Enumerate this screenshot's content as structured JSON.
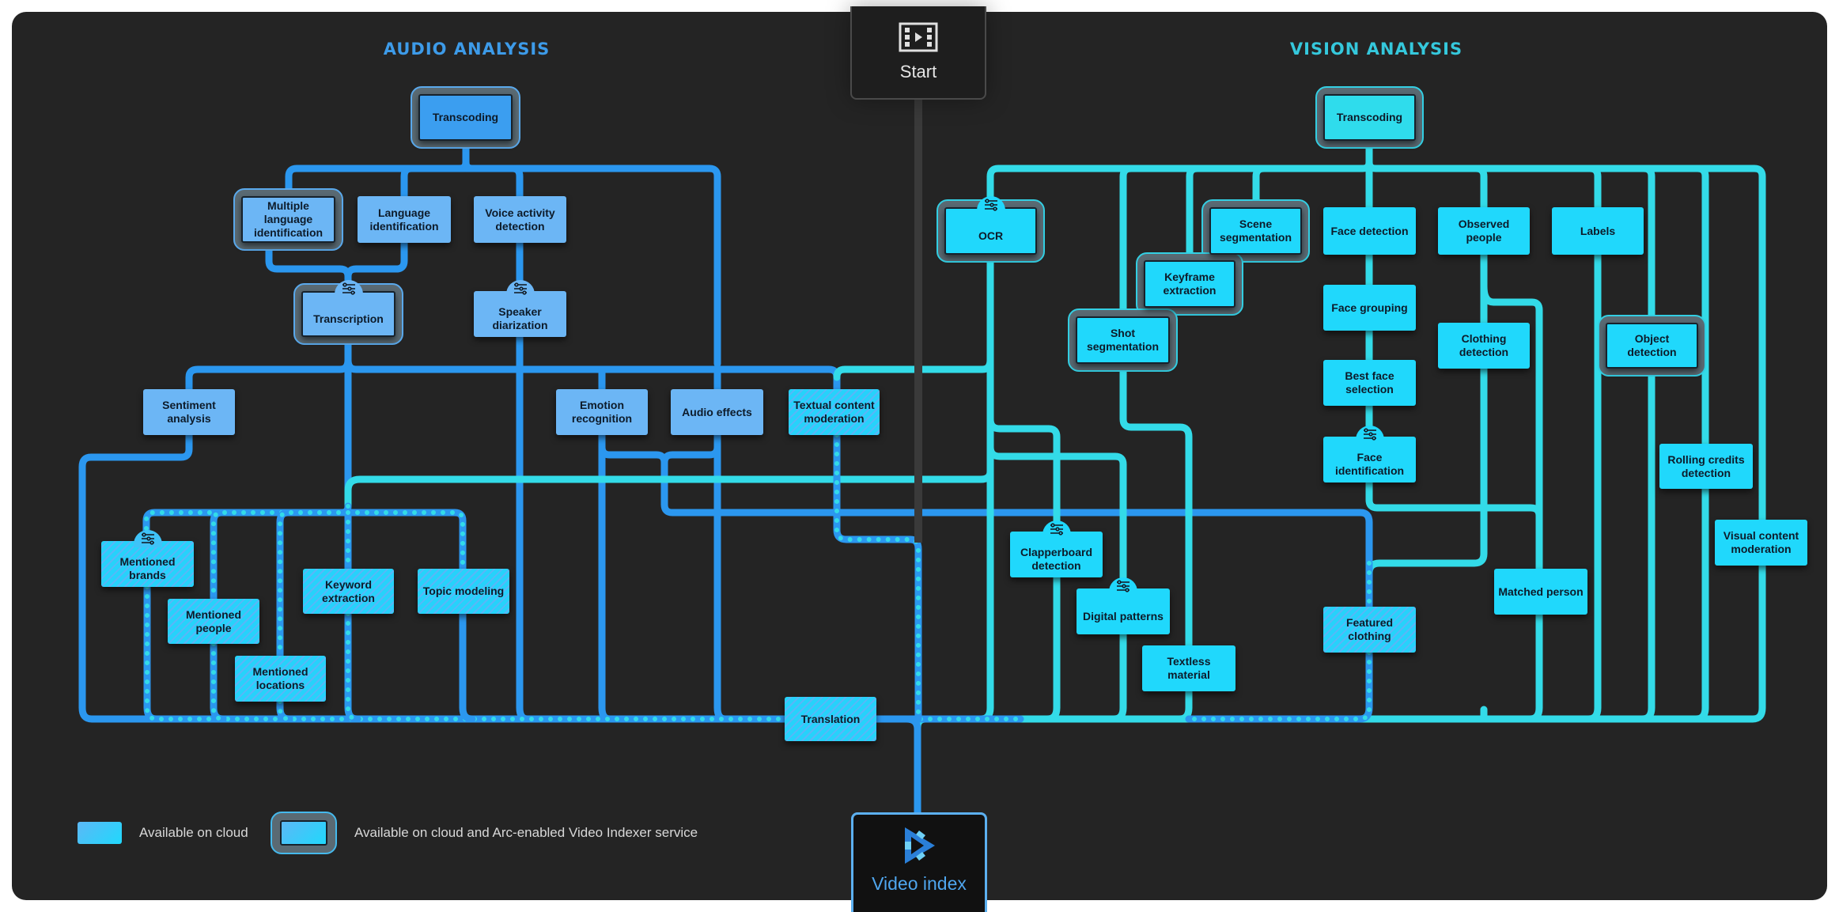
{
  "headers": {
    "audio": "AUDIO ANALYSIS",
    "vision": "VISION ANALYSIS"
  },
  "start": {
    "label": "Start",
    "icon": "film-play-icon"
  },
  "end": {
    "label": "Video index",
    "icon": "video-indexer-logo-icon"
  },
  "colors": {
    "audio_line": "#2b97ef",
    "vision_line": "#33dbe8",
    "audio_node": "#6cb6f5",
    "vision_node": "#20d8fc",
    "background": "#242424"
  },
  "legend": [
    {
      "label": "Available on cloud",
      "kind": "cloud"
    },
    {
      "label": "Available on cloud and Arc-enabled Video Indexer service",
      "kind": "cloud-and-arc"
    }
  ],
  "nodes": [
    {
      "id": "a_transcoding",
      "label": "Transcoding",
      "group": "audio",
      "arc": true,
      "configurable": false,
      "mixed": false
    },
    {
      "id": "a_multilang",
      "label": "Multiple language identification",
      "group": "audio",
      "arc": true,
      "configurable": false,
      "mixed": false
    },
    {
      "id": "a_langid",
      "label": "Language identification",
      "group": "audio",
      "arc": false,
      "configurable": false,
      "mixed": false
    },
    {
      "id": "a_vad",
      "label": "Voice activity detection",
      "group": "audio",
      "arc": false,
      "configurable": false,
      "mixed": false
    },
    {
      "id": "a_transcription",
      "label": "Transcription",
      "group": "audio",
      "arc": true,
      "configurable": true,
      "mixed": false
    },
    {
      "id": "a_diarization",
      "label": "Speaker diarization",
      "group": "audio",
      "arc": false,
      "configurable": true,
      "mixed": false
    },
    {
      "id": "a_sentiment",
      "label": "Sentiment analysis",
      "group": "audio",
      "arc": false,
      "configurable": false,
      "mixed": false
    },
    {
      "id": "a_emotion",
      "label": "Emotion recognition",
      "group": "audio",
      "arc": false,
      "configurable": false,
      "mixed": false
    },
    {
      "id": "a_effects",
      "label": "Audio effects",
      "group": "audio",
      "arc": false,
      "configurable": false,
      "mixed": false
    },
    {
      "id": "a_textmod",
      "label": "Textual content moderation",
      "group": "mixed",
      "arc": false,
      "configurable": false,
      "mixed": true
    },
    {
      "id": "a_brands",
      "label": "Mentioned brands",
      "group": "mixed",
      "arc": false,
      "configurable": true,
      "mixed": true
    },
    {
      "id": "a_keywords",
      "label": "Keyword extraction",
      "group": "mixed",
      "arc": false,
      "configurable": false,
      "mixed": true
    },
    {
      "id": "a_topics",
      "label": "Topic modeling",
      "group": "mixed",
      "arc": false,
      "configurable": false,
      "mixed": true
    },
    {
      "id": "a_people",
      "label": "Mentioned people",
      "group": "mixed",
      "arc": false,
      "configurable": false,
      "mixed": true
    },
    {
      "id": "a_locations",
      "label": "Mentioned locations",
      "group": "mixed",
      "arc": false,
      "configurable": false,
      "mixed": true
    },
    {
      "id": "a_translation",
      "label": "Translation",
      "group": "mixed",
      "arc": false,
      "configurable": false,
      "mixed": true
    },
    {
      "id": "v_transcoding",
      "label": "Transcoding",
      "group": "vision",
      "arc": true,
      "configurable": false,
      "mixed": false
    },
    {
      "id": "v_ocr",
      "label": "OCR",
      "group": "vision",
      "arc": true,
      "configurable": true,
      "mixed": false
    },
    {
      "id": "v_scene",
      "label": "Scene segmentation",
      "group": "vision",
      "arc": true,
      "configurable": false,
      "mixed": false
    },
    {
      "id": "v_keyframe",
      "label": "Keyframe extraction",
      "group": "vision",
      "arc": true,
      "configurable": false,
      "mixed": false
    },
    {
      "id": "v_shot",
      "label": "Shot segmentation",
      "group": "vision",
      "arc": true,
      "configurable": false,
      "mixed": false
    },
    {
      "id": "v_facedet",
      "label": "Face detection",
      "group": "vision",
      "arc": false,
      "configurable": false,
      "mixed": false
    },
    {
      "id": "v_observed",
      "label": "Observed people",
      "group": "vision",
      "arc": false,
      "configurable": false,
      "mixed": false
    },
    {
      "id": "v_labels",
      "label": "Labels",
      "group": "vision",
      "arc": false,
      "configurable": false,
      "mixed": false
    },
    {
      "id": "v_facegroup",
      "label": "Face grouping",
      "group": "vision",
      "arc": false,
      "configurable": false,
      "mixed": false
    },
    {
      "id": "v_clothing",
      "label": "Clothing detection",
      "group": "vision",
      "arc": false,
      "configurable": false,
      "mixed": false
    },
    {
      "id": "v_object",
      "label": "Object detection",
      "group": "vision",
      "arc": true,
      "configurable": false,
      "mixed": false
    },
    {
      "id": "v_bestface",
      "label": "Best face selection",
      "group": "vision",
      "arc": false,
      "configurable": false,
      "mixed": false
    },
    {
      "id": "v_faceid",
      "label": "Face identification",
      "group": "vision",
      "arc": false,
      "configurable": true,
      "mixed": false
    },
    {
      "id": "v_credits",
      "label": "Rolling credits detection",
      "group": "vision",
      "arc": false,
      "configurable": false,
      "mixed": false
    },
    {
      "id": "v_visualmod",
      "label": "Visual content moderation",
      "group": "vision",
      "arc": false,
      "configurable": false,
      "mixed": false
    },
    {
      "id": "v_clapper",
      "label": "Clapperboard detection",
      "group": "vision",
      "arc": false,
      "configurable": true,
      "mixed": false
    },
    {
      "id": "v_digital",
      "label": "Digital patterns",
      "group": "vision",
      "arc": false,
      "configurable": true,
      "mixed": false
    },
    {
      "id": "v_textless",
      "label": "Textless material",
      "group": "vision",
      "arc": false,
      "configurable": false,
      "mixed": false
    },
    {
      "id": "v_matched",
      "label": "Matched person",
      "group": "vision",
      "arc": false,
      "configurable": false,
      "mixed": false
    },
    {
      "id": "v_featured",
      "label": "Featured clothing",
      "group": "mixed",
      "arc": false,
      "configurable": false,
      "mixed": true
    }
  ]
}
